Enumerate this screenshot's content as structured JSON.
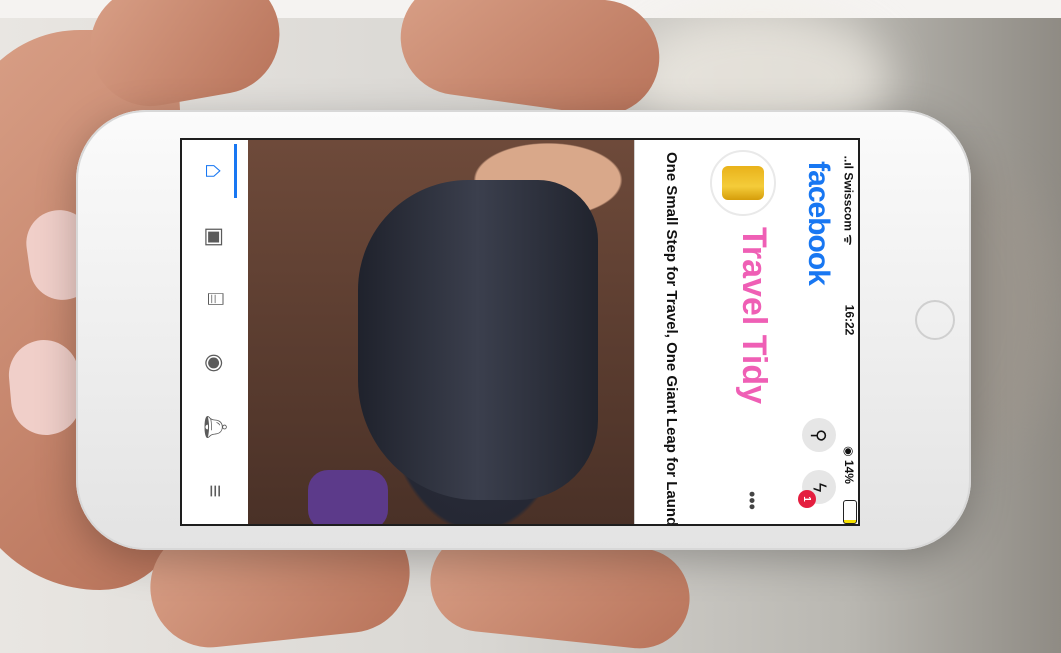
{
  "status_bar": {
    "carrier": "..ıl Swisscom ᯤ",
    "time": "16:22",
    "battery": "◉ 14%"
  },
  "app": {
    "brand": "facebook",
    "brand_color": "#1877F2"
  },
  "post": {
    "page_name": "Travel Tidy",
    "page_name_color": "#EF5FB5",
    "caption": "One Small Step for Travel, One Giant Leap for Laundry #TravelTidy",
    "avatar_icon": "suitcase-icon"
  },
  "header_actions": {
    "search_icon": "search-icon",
    "messenger_icon": "messenger-icon",
    "messenger_badge": "1",
    "more_icon": "more-options-icon"
  },
  "nav": {
    "items": [
      {
        "name": "home-icon"
      },
      {
        "name": "watch-icon"
      },
      {
        "name": "marketplace-icon"
      },
      {
        "name": "groups-icon"
      },
      {
        "name": "notifications-icon"
      },
      {
        "name": "menu-icon"
      }
    ]
  }
}
